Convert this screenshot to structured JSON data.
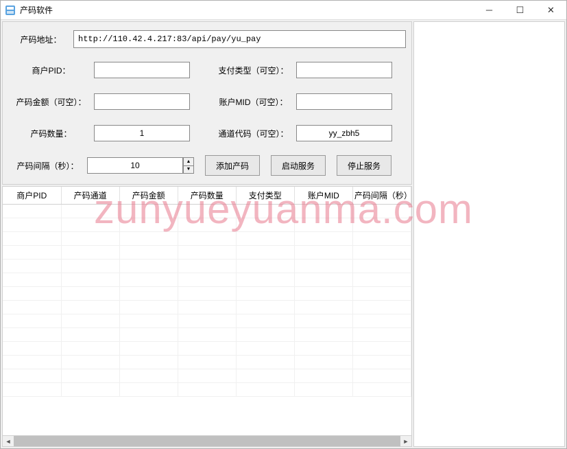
{
  "window": {
    "title": "产码软件"
  },
  "form": {
    "address_label": "产码地址：",
    "address_value": "http://110.42.4.217:83/api/pay/yu_pay",
    "pid_label": "商户PID：",
    "pid_value": "",
    "paytype_label": "支付类型（可空）：",
    "paytype_value": "",
    "amount_label": "产码金额（可空）：",
    "amount_value": "",
    "mid_label": "账户MID（可空）：",
    "mid_value": "",
    "count_label": "产码数量：",
    "count_value": "1",
    "channel_label": "通道代码（可空）：",
    "channel_value": "yy_zbh5",
    "interval_label": "产码间隔（秒）：",
    "interval_value": "10"
  },
  "buttons": {
    "add": "添加产码",
    "start": "启动服务",
    "stop": "停止服务"
  },
  "table": {
    "columns": [
      "商户PID",
      "产码通道",
      "产码金额",
      "产码数量",
      "支付类型",
      "账户MID",
      "产码间隔（秒）"
    ]
  },
  "watermark": "zunyueyuanma.com"
}
